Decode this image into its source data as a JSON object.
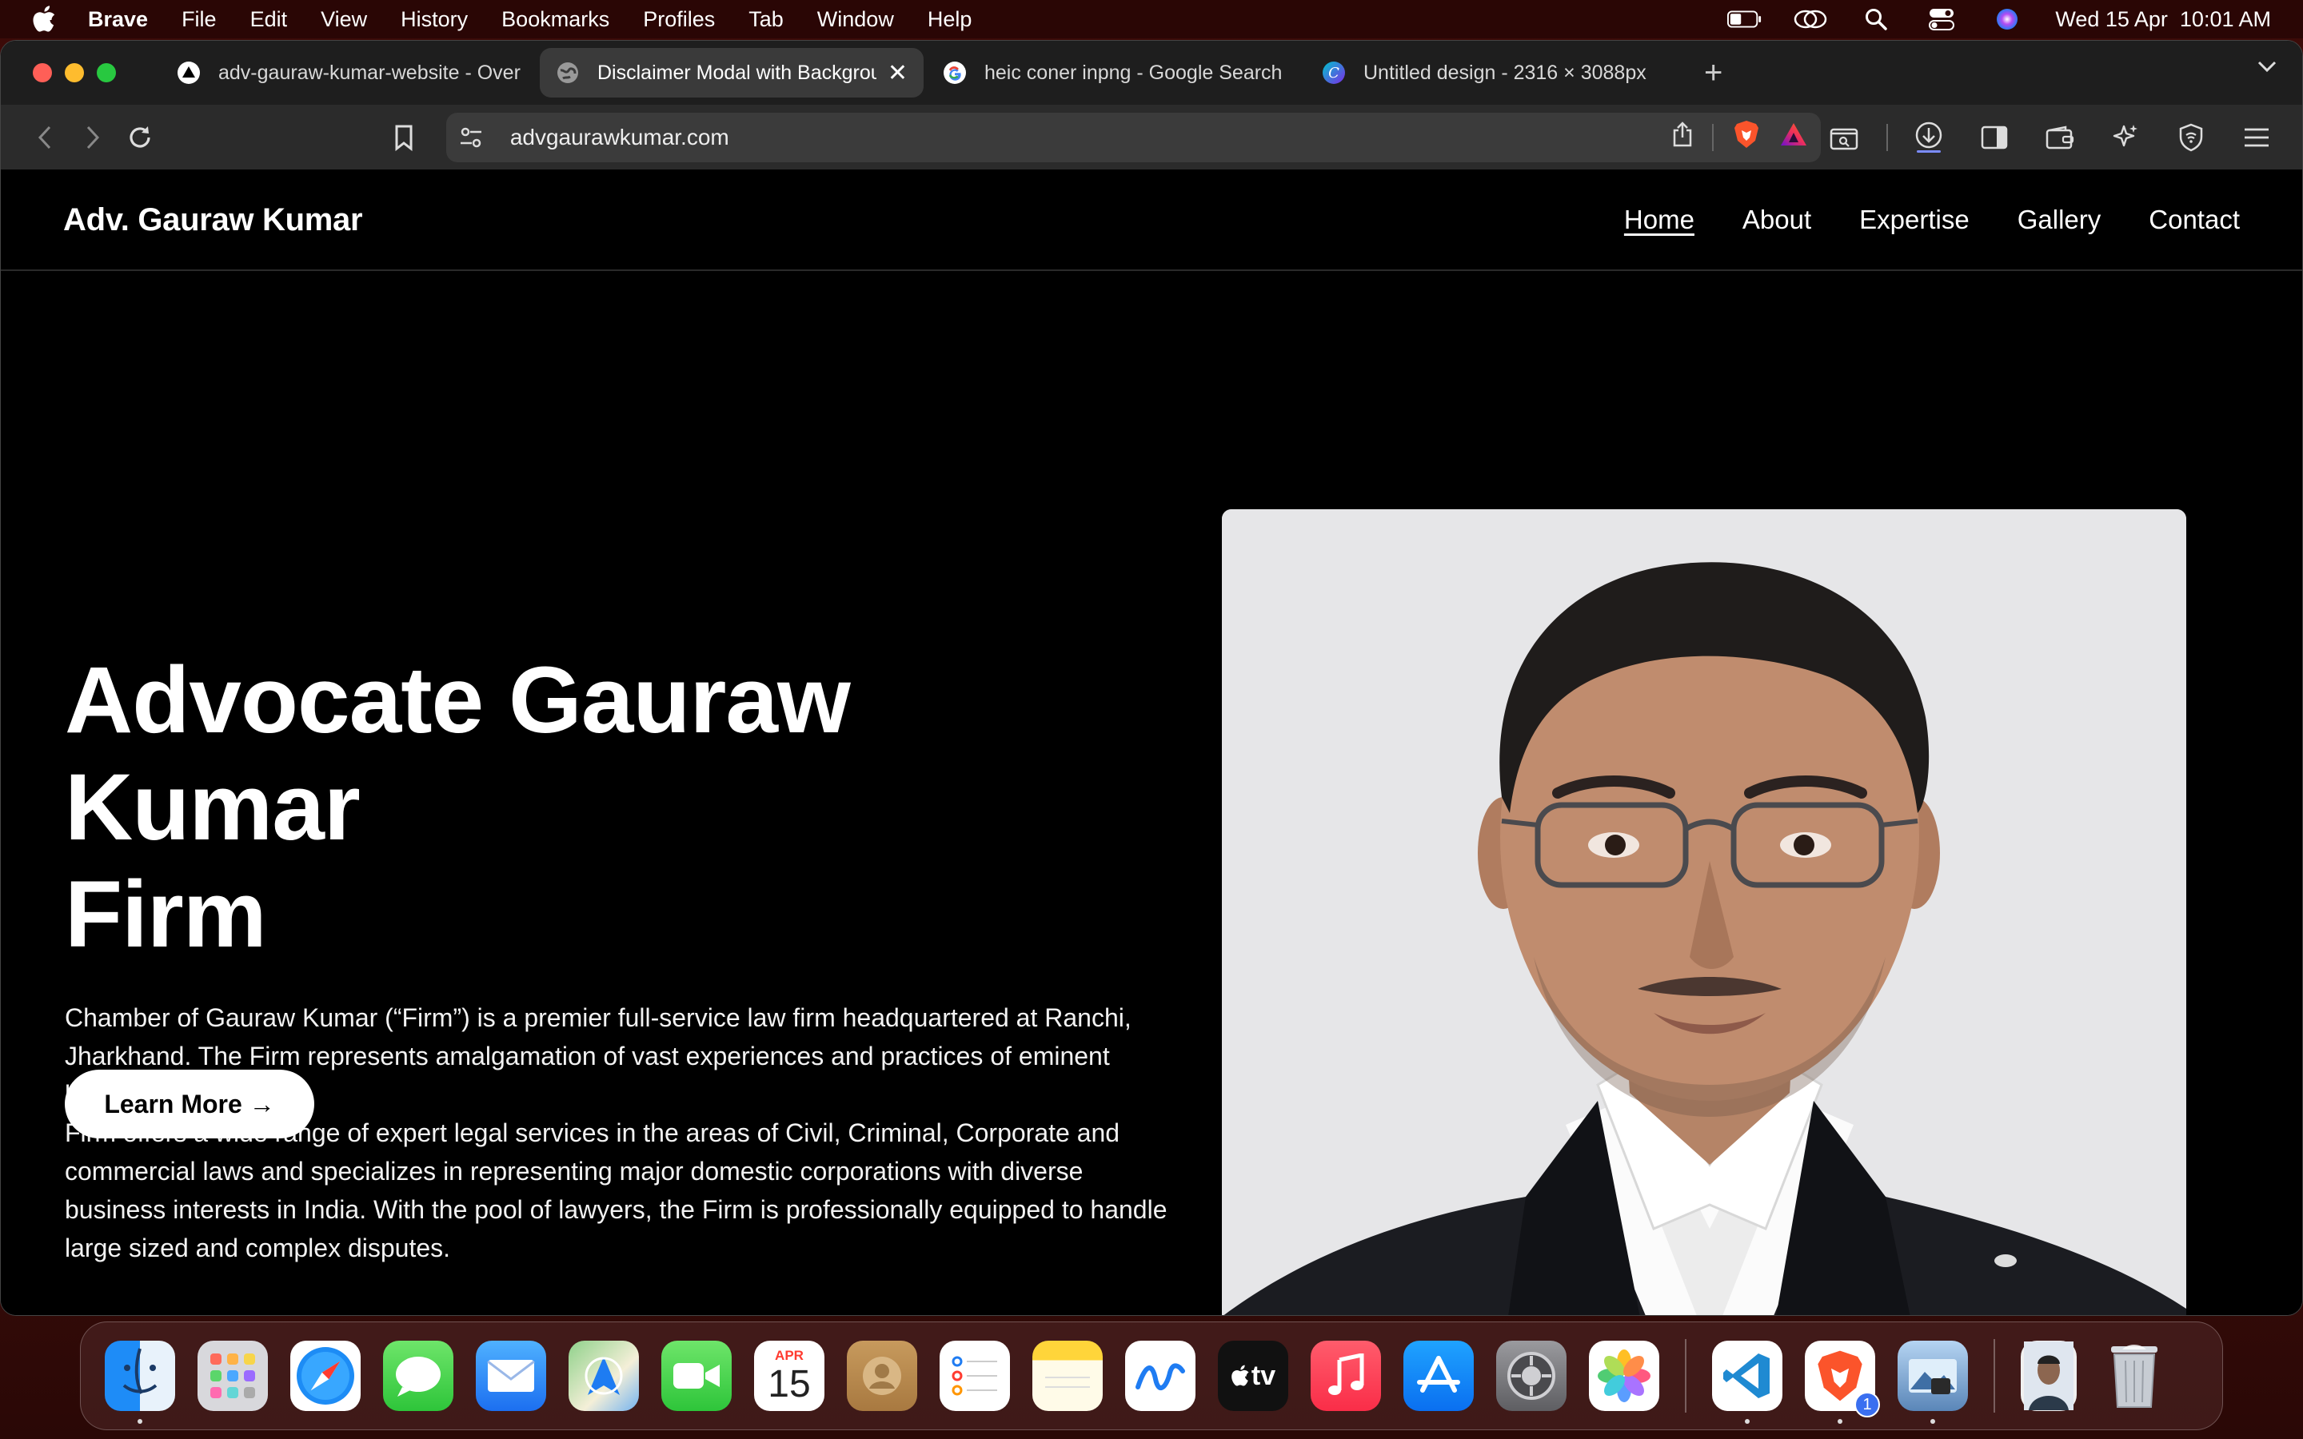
{
  "menubar": {
    "app_name": "Brave",
    "items": [
      "File",
      "Edit",
      "View",
      "History",
      "Bookmarks",
      "Profiles",
      "Tab",
      "Window",
      "Help"
    ],
    "datetime": "Wed 15 Apr  10:01 AM"
  },
  "tabs": [
    {
      "title": "adv-gauraw-kumar-website - Overview",
      "favicon": "vercel-icon"
    },
    {
      "title": "Disclaimer Modal with Background",
      "favicon": "globe-icon",
      "active": true
    },
    {
      "title": "heic coner inpng - Google Search",
      "favicon": "google-icon"
    },
    {
      "title": "Untitled design - 2316 × 3088px",
      "favicon": "canva-icon"
    }
  ],
  "toolbar": {
    "url": "advgaurawkumar.com"
  },
  "site": {
    "brand": "Adv. Gauraw Kumar",
    "nav": [
      "Home",
      "About",
      "Expertise",
      "Gallery",
      "Contact"
    ],
    "hero": {
      "title_line1": "Advocate Gauraw Kumar",
      "title_line2": "Firm",
      "para1": "Chamber of Gauraw Kumar (“Firm”) is a premier full-service law firm headquartered at Ranchi, Jharkhand. The Firm represents amalgamation of vast experiences and practices of eminent lawyers.",
      "para2": "Firm offers a wide range of expert legal services in the areas of Civil, Criminal, Corporate and commercial laws and specializes in representing major domestic corporations with diverse business interests in India. With the pool of lawyers, the Firm is professionally equipped to handle large sized and complex disputes.",
      "cta": "Learn More →"
    }
  },
  "dock": {
    "calendar_month": "APR",
    "calendar_day": "15",
    "brave_badge": "1",
    "appletv_label": "tv"
  },
  "colors": {
    "accent_red": "#ff5f57",
    "accent_yellow": "#febc2e",
    "accent_green": "#28c840",
    "page_bg": "#000000"
  }
}
